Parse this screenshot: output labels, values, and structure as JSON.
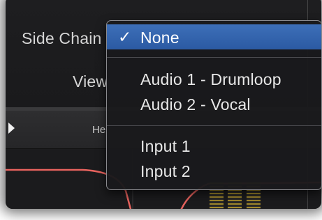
{
  "plugin": {
    "side_chain_label": "Side Chain",
    "view_label": "View",
    "header_text": "He"
  },
  "side_chain_menu": {
    "selected_check": "✓",
    "items": [
      {
        "label": "None",
        "selected": true
      },
      {
        "label": "Audio 1 - Drumloop",
        "selected": false
      },
      {
        "label": "Audio 2 - Vocal",
        "selected": false
      },
      {
        "label": "Input 1",
        "selected": false
      },
      {
        "label": "Input 2",
        "selected": false
      }
    ]
  },
  "colors": {
    "selection": "#2f5fa8",
    "curve": "#e8635e",
    "meter": "#b79a2e",
    "menu_background": "#1a1a1c",
    "text": "#e8e8e8"
  },
  "icons": {
    "play": "play-triangle-icon",
    "check": "checkmark-icon"
  }
}
